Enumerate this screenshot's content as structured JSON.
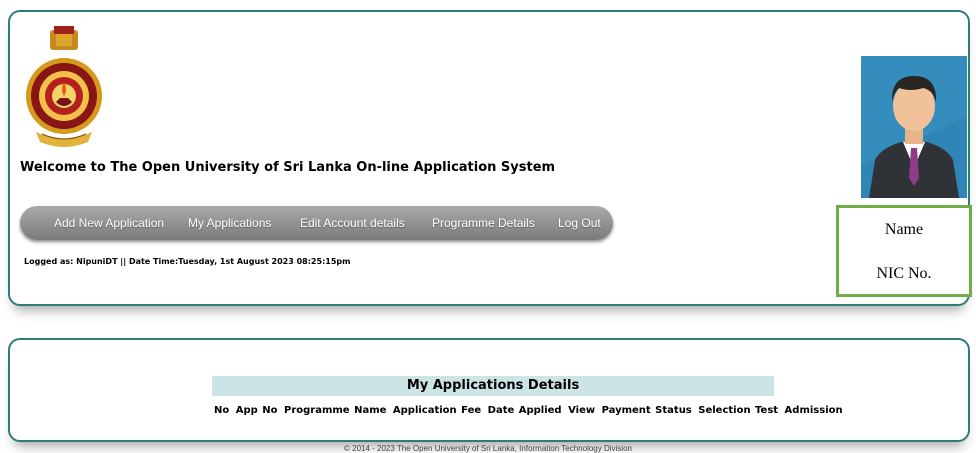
{
  "header": {
    "welcome": "Welcome to The Open University of Sri Lanka On-line Application System",
    "logged_info": "Logged as: NipuniDT || Date Time:Tuesday, 1st August 2023 08:25:15pm"
  },
  "nav": {
    "items": [
      {
        "label": "Add New Application"
      },
      {
        "label": "My Applications"
      },
      {
        "label": "Edit Account details"
      },
      {
        "label": "Programme Details"
      },
      {
        "label": "Log Out"
      }
    ]
  },
  "profile": {
    "name_label": "Name",
    "nic_label": "NIC No."
  },
  "applications": {
    "title": "My Applications Details",
    "columns": [
      "No",
      "App No",
      "Programme Name",
      "Application Fee",
      "Date Applied",
      "View",
      "Payment Status",
      "Selection Test",
      "Admission"
    ]
  },
  "footer": {
    "text": "© 2014 - 2023 The Open University of Sri Lanka, Information Technology Division"
  },
  "colors": {
    "panel_border": "#2e7d7a",
    "nav_bar": "#8c8c8c",
    "table_header_bg": "#cde4e6",
    "id_box_border": "#70ad47",
    "photo_bg": "#2f86b6"
  }
}
